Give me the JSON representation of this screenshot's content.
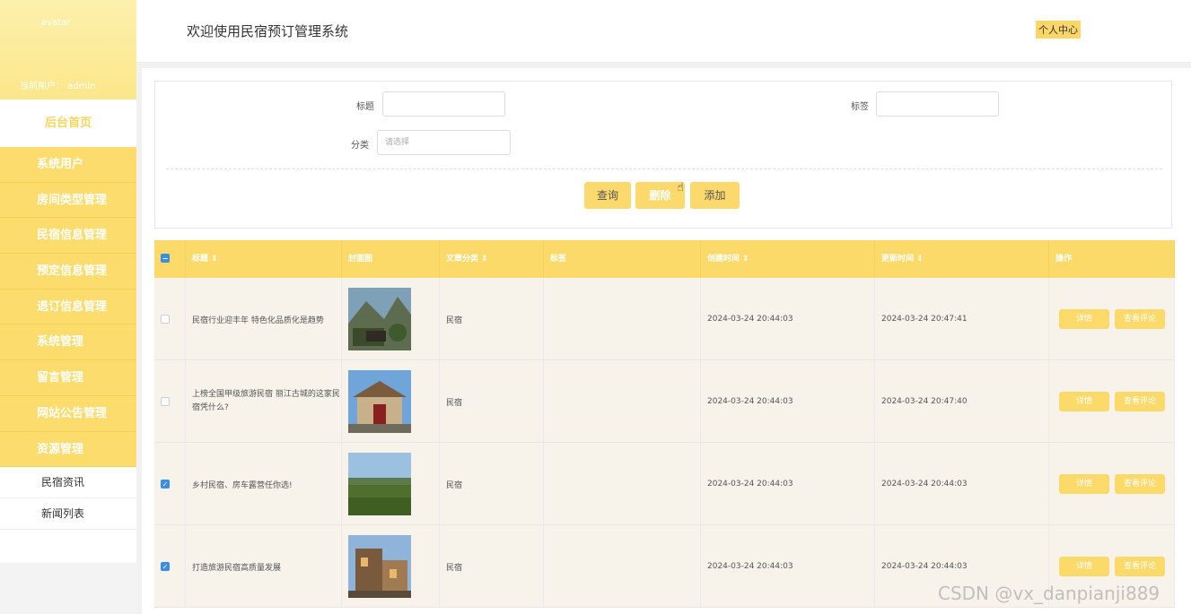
{
  "sidebar": {
    "avatar_alt": "avatar",
    "current_user": "当前用户： admin",
    "home": "后台首页",
    "items": [
      {
        "label": "系统用户"
      },
      {
        "label": "房间类型管理"
      },
      {
        "label": "民宿信息管理"
      },
      {
        "label": "预定信息管理"
      },
      {
        "label": "退订信息管理"
      },
      {
        "label": "系统管理"
      },
      {
        "label": "留言管理"
      },
      {
        "label": "网站公告管理"
      },
      {
        "label": "资源管理"
      }
    ],
    "subitems": [
      {
        "label": "民宿资讯"
      },
      {
        "label": "新闻列表"
      }
    ]
  },
  "header": {
    "title": "欢迎使用民宿预订管理系统",
    "personal_center": "个人中心"
  },
  "search": {
    "title_label": "标题",
    "tag_label": "标签",
    "category_label": "分类",
    "category_placeholder": "请选择",
    "query_button": "查询",
    "delete_button": "删除",
    "add_button": "添加"
  },
  "table": {
    "headers": [
      "标题",
      "封面图",
      "文章分类",
      "标签",
      "创建时间",
      "更新时间",
      "操作"
    ],
    "detail_label": "详情",
    "comments_label": "查看评论",
    "rows": [
      {
        "title": "民宿行业迎丰年 特色化品质化是趋势",
        "category": "民宿",
        "tag": "",
        "created": "2024-03-24 20:44:03",
        "updated": "2024-03-24 20:47:41",
        "checked": false
      },
      {
        "title": "上榜全国甲级旅游民宿 丽江古城的这家民宿凭什么?",
        "category": "民宿",
        "tag": "",
        "created": "2024-03-24 20:44:03",
        "updated": "2024-03-24 20:47:40",
        "checked": false
      },
      {
        "title": "乡村民宿、房车露营任你选!",
        "category": "民宿",
        "tag": "",
        "created": "2024-03-24 20:44:03",
        "updated": "2024-03-24 20:44:03",
        "checked": true
      },
      {
        "title": "打造旅游民宿高质量发展",
        "category": "民宿",
        "tag": "",
        "created": "2024-03-24 20:44:03",
        "updated": "2024-03-24 20:44:03",
        "checked": true
      }
    ]
  },
  "watermark": "CSDN @vx_danpianji889",
  "colors": {
    "accent": "#fbda6a",
    "sidebar_menu": "#fcdc6c",
    "checkbox_blue": "#3a8ee6"
  }
}
